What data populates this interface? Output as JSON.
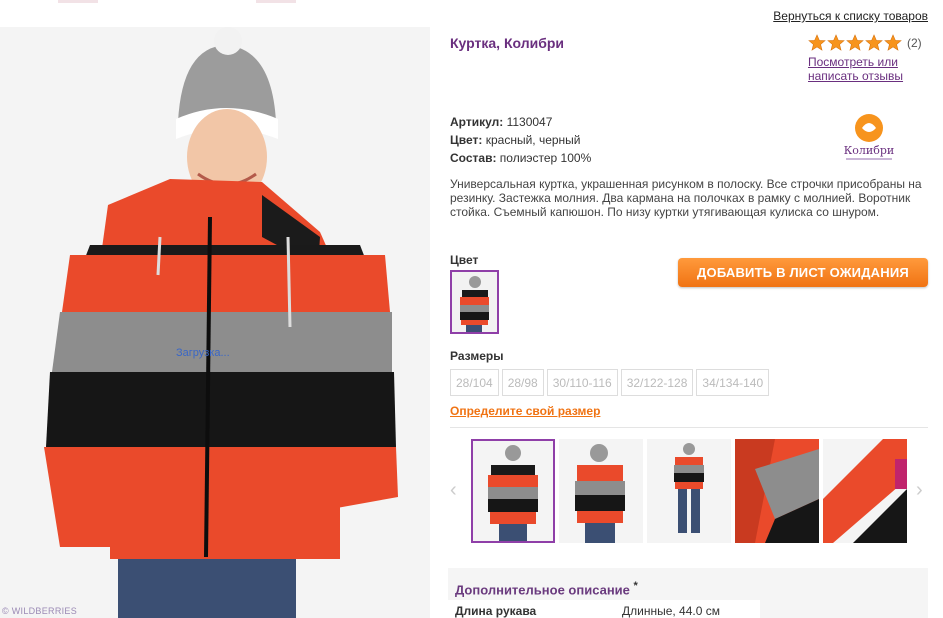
{
  "header": {
    "back_link": "Вернуться к списку товаров"
  },
  "main_image": {
    "loading_text": "Загрузка...",
    "watermark": "© WILDBERRIES"
  },
  "product": {
    "title": "Куртка, Колибри",
    "rating": {
      "stars": 5,
      "max": 5,
      "count": "(2)",
      "reviews_link": "Посмотреть или написать отзывы"
    },
    "specs": [
      {
        "label": "Артикул:",
        "value": "1130047"
      },
      {
        "label": "Цвет:",
        "value": "красный, черный"
      },
      {
        "label": "Состав:",
        "value": "полиэстер 100%"
      }
    ],
    "brand_logo_text": "Колибри",
    "description": "Универсальная куртка, украшенная рисунком в полоску. Все строчки присобраны на резинку. Застежка молния. Два кармана на полочках в рамку с молнией. Воротник стойка. Съемный капюшон. По низу куртки утягивающая кулиска со шнуром."
  },
  "color": {
    "label": "Цвет"
  },
  "wait_button": "ДОБАВИТЬ В ЛИСТ ОЖИДАНИЯ",
  "sizes": {
    "label": "Размеры",
    "items": [
      "28/104",
      "28/98",
      "30/110-116",
      "32/122-128",
      "34/134-140"
    ],
    "size_link": "Определите свой размер"
  },
  "additional": {
    "title": "Дополнительное описание",
    "asterisk": "*",
    "rows": [
      {
        "key": "Длина рукава",
        "value": "Длинные, 44.0 см"
      }
    ]
  },
  "colors": {
    "accent": "#6a2f7f",
    "button": "#f07313",
    "star": "#f7941d"
  }
}
